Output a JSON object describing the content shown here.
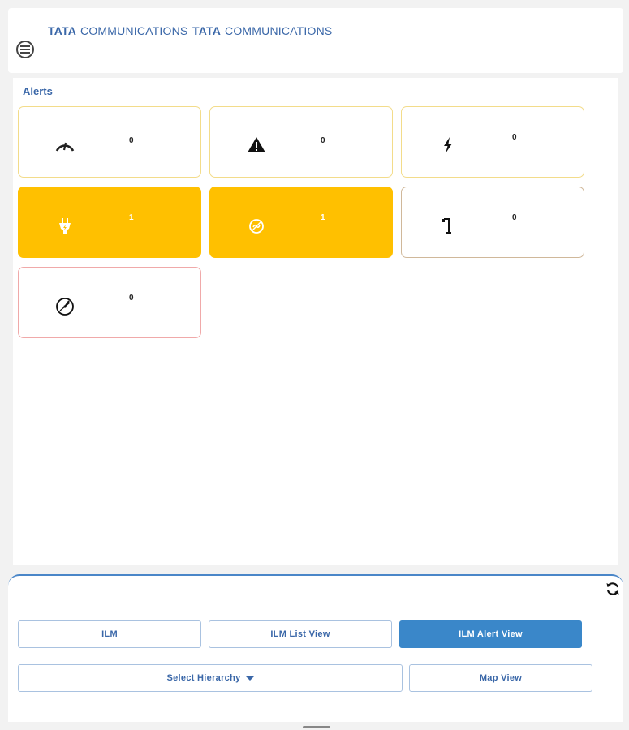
{
  "header": {
    "logos": [
      {
        "bold": "TATA",
        "rest": "COMMUNICATIONS"
      },
      {
        "bold": "TATA",
        "rest": "COMMUNICATIONS"
      }
    ],
    "menu_icon": "hamburger-menu-icon"
  },
  "alerts": {
    "title": "Alerts",
    "cards": [
      {
        "icon": "speedometer-icon",
        "count": "0"
      },
      {
        "icon": "warning-icon",
        "count": "0"
      },
      {
        "icon": "lightning-bolt-icon",
        "count": "0"
      },
      {
        "icon": "power-plug-icon",
        "count": "1"
      },
      {
        "icon": "no-signal-icon",
        "count": "1"
      },
      {
        "icon": "street-light-icon",
        "count": "0"
      },
      {
        "icon": "meter-gauge-icon",
        "count": "0"
      }
    ]
  },
  "bottom": {
    "refresh_icon": "refresh-icon",
    "tabs": {
      "ilm": "ILM",
      "ilm_list_view": "ILM List View",
      "ilm_alert_view": "ILM Alert View"
    },
    "select_hierarchy": "Select Hierarchy",
    "map_view": "Map View"
  },
  "colors": {
    "brand_blue": "#3a67a8",
    "primary_button": "#3a87c9",
    "alert_yellow": "#ffc000",
    "card_border_yellow": "#f3dc8a",
    "card_border_brown": "#d0b89a",
    "card_border_pink": "#f0a9a9"
  }
}
